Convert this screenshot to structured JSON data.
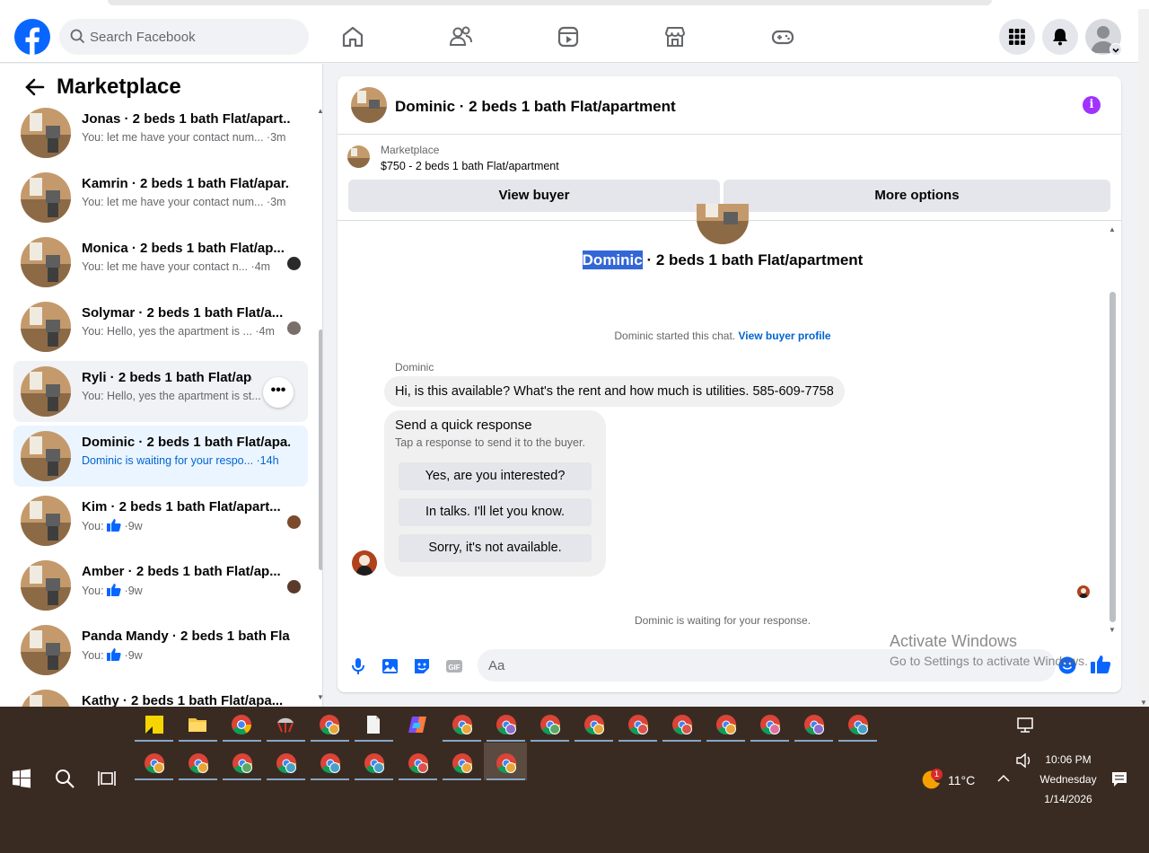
{
  "header": {
    "search_placeholder": "Search Facebook",
    "brand_color": "#0866ff"
  },
  "left": {
    "title": "Marketplace",
    "conversations": [
      {
        "name": "Jonas · 2 beds 1 bath Flat/apart...",
        "preview": "You: let me have your contact num... ·3m"
      },
      {
        "name": "Kamrin · 2 beds 1 bath Flat/apar...",
        "preview": "You: let me have your contact num... ·3m"
      },
      {
        "name": "Monica · 2 beds 1 bath Flat/ap...",
        "preview": "You: let me have your contact n... ·4m"
      },
      {
        "name": "Solymar · 2 beds 1 bath Flat/a...",
        "preview": "You: Hello, yes the apartment is ... ·4m"
      },
      {
        "name": "Ryli · 2 beds 1 bath Flat/apart...",
        "preview": "You: Hello, yes the apartment is st... ·4m"
      },
      {
        "name": "Dominic · 2 beds 1 bath Flat/apa...",
        "preview": "Dominic is waiting for your respo... ·14h"
      },
      {
        "name": "Kim · 2 beds 1 bath Flat/apart...",
        "preview_prefix": "You:",
        "preview_suffix": "·9w"
      },
      {
        "name": "Amber · 2 beds 1 bath Flat/ap...",
        "preview_prefix": "You:",
        "preview_suffix": "·9w"
      },
      {
        "name": "Panda Mandy · 2 beds 1 bath Fla...",
        "preview_prefix": "You:",
        "preview_suffix": "·9w"
      },
      {
        "name": "Kathy · 2 beds 1 bath Flat/apa..."
      }
    ]
  },
  "chat": {
    "header_title": "Dominic · 2 beds 1 bath Flat/apartment",
    "marketplace_label": "Marketplace",
    "listing_price": "$750 - 2 beds 1 bath Flat/apartment",
    "view_buyer": "View buyer",
    "more_options": "More options",
    "listing_title_highlight": "Dominic",
    "listing_title_rest": " · 2 beds 1 bath Flat/apartment",
    "started_text": "Dominic started this chat. ",
    "view_buyer_profile": "View buyer profile",
    "sender_name": "Dominic",
    "message": "Hi, is this available? What's the rent and how much is utilities. 585-609-7758",
    "quick_title": "Send a quick response",
    "quick_subtitle": "Tap a response to send it to the buyer.",
    "quick_responses": [
      "Yes, are you interested?",
      "In talks. I'll let you know.",
      "Sorry, it's not available."
    ],
    "waiting_text": "Dominic is waiting for your response.",
    "composer_placeholder": "Aa"
  },
  "watermark": {
    "line1": "Activate Windows",
    "line2": "Go to Settings to activate Windows."
  },
  "taskbar": {
    "weather_temp": "11°C",
    "weather_badge": "1",
    "time": "10:06 PM",
    "day": "Wednesday",
    "date": "1/14/2026"
  }
}
